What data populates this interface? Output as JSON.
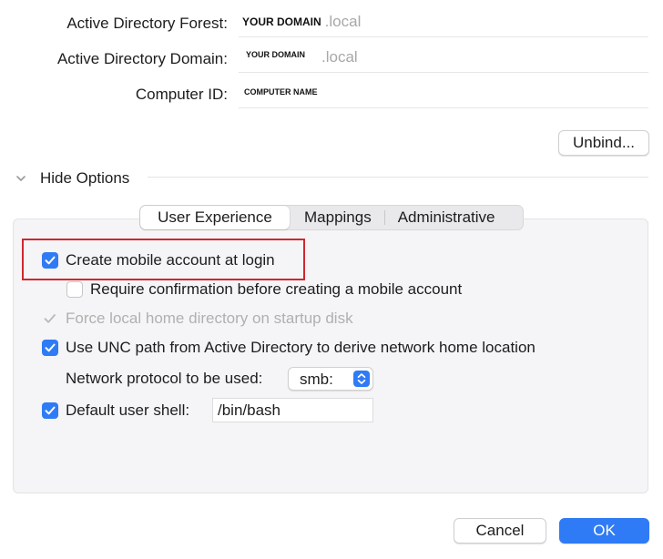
{
  "fields": {
    "forest": {
      "label": "Active Directory Forest:",
      "value": "YOUR DOMAIN",
      "suffix": ".local"
    },
    "domain": {
      "label": "Active Directory Domain:",
      "value": "YOUR DOMAIN",
      "suffix": ".local"
    },
    "computer_id": {
      "label": "Computer ID:",
      "value": "COMPUTER NAME"
    }
  },
  "buttons": {
    "unbind": "Unbind...",
    "cancel": "Cancel",
    "ok": "OK"
  },
  "disclosure": {
    "label": "Hide Options",
    "expanded": true
  },
  "tabs": [
    {
      "label": "User Experience",
      "active": true
    },
    {
      "label": "Mappings",
      "active": false
    },
    {
      "label": "Administrative",
      "active": false
    }
  ],
  "options": {
    "mobile_account": {
      "label": "Create mobile account at login",
      "checked": true,
      "enabled": true
    },
    "require_confirmation": {
      "label": "Require confirmation before creating a mobile account",
      "checked": false,
      "enabled": true
    },
    "force_local_home": {
      "label": "Force local home directory on startup disk",
      "checked": true,
      "enabled": false
    },
    "use_unc": {
      "label": "Use UNC path from Active Directory to derive network home location",
      "checked": true,
      "enabled": true
    },
    "network_protocol": {
      "label": "Network protocol to be used:",
      "selected": "smb:"
    },
    "default_shell": {
      "label": "Default user shell:",
      "checked": true,
      "enabled": true,
      "value": "/bin/bash"
    }
  },
  "colors": {
    "accent": "#2f7bf5",
    "highlight_border": "#d0272f",
    "disabled_text": "#b0b0b0",
    "panel_bg": "#f5f5f7"
  },
  "icons": {
    "disclosure": "chevron-down-icon",
    "checkmark": "checkmark-icon",
    "popup_stepper": "chevron-updown-icon"
  }
}
